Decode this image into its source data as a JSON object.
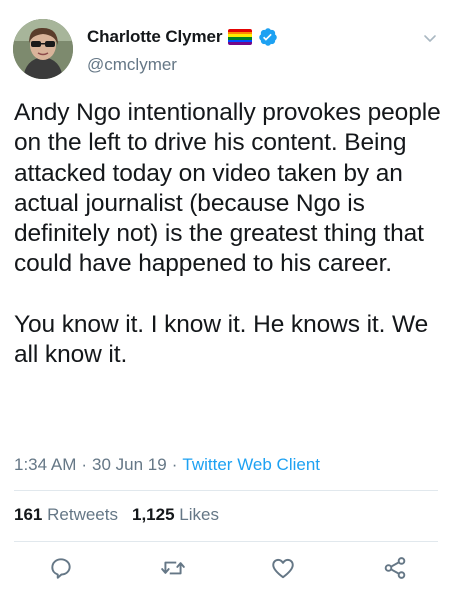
{
  "user": {
    "display_name": "Charlotte Clymer",
    "handle": "@cmclymer"
  },
  "tweet": {
    "text": "Andy Ngo intentionally provokes people on the left to drive his content. Being attacked today on video taken by an actual journalist (because Ngo is definitely not) is the greatest thing that could have happened to his career.\n\nYou know it. I know it. He knows it. We all know it.",
    "time": "1:34 AM",
    "date": "30 Jun 19",
    "separator": "·",
    "client": "Twitter Web Client"
  },
  "stats": {
    "retweets_count": "161",
    "retweets_label": "Retweets",
    "likes_count": "1,125",
    "likes_label": "Likes"
  },
  "icons": {
    "flag": "rainbow-flag-icon",
    "verified": "verified-badge-icon",
    "caret": "chevron-down-icon",
    "reply": "reply-icon",
    "retweet": "retweet-icon",
    "like": "heart-icon",
    "share": "share-icon"
  },
  "colors": {
    "accent": "#1da1f2",
    "secondary_text": "#657786",
    "primary_text": "#14171a",
    "divider": "#e1e8ed"
  }
}
